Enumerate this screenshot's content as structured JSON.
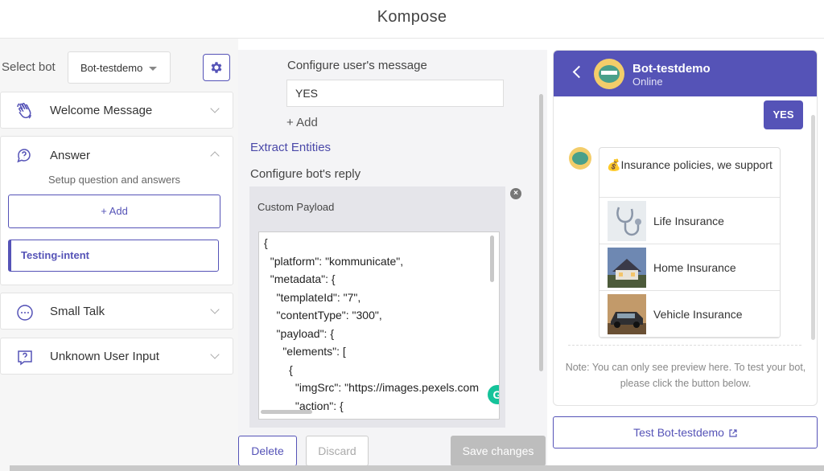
{
  "app": {
    "title": "Kompose"
  },
  "sidebar": {
    "select_label": "Select bot",
    "selected_bot": "Bot-testdemo",
    "sections": [
      {
        "label": "Welcome Message",
        "icon": "wave-hand-icon"
      },
      {
        "label": "Answer",
        "icon": "question-bubble-icon",
        "subtitle": "Setup question and answers",
        "add_label": "+ Add",
        "intent": "Testing-intent"
      },
      {
        "label": "Small Talk",
        "icon": "chat-dots-icon"
      },
      {
        "label": "Unknown User Input",
        "icon": "unknown-question-icon"
      }
    ]
  },
  "editor": {
    "user_message_label": "Configure user's message",
    "user_message_value": "YES",
    "add_label": "+ Add",
    "extract_entities": "Extract Entities",
    "bot_reply_label": "Configure bot's reply",
    "payload_title": "Custom Payload",
    "payload_code": "{\n  \"platform\": \"kommunicate\",\n  \"metadata\": {\n    \"templateId\": \"7\",\n    \"contentType\": \"300\",\n    \"payload\": {\n      \"elements\": [\n        {\n          \"imgSrc\": \"https://images.pexels.com\n          \"action\": {",
    "delete_label": "Delete",
    "discard_label": "Discard",
    "save_label": "Save changes"
  },
  "preview": {
    "bot_name": "Bot-testdemo",
    "status": "Online",
    "user_message": "YES",
    "list_title_emoji": "💰",
    "list_title": "Insurance policies, we support",
    "items": [
      {
        "label": "Life Insurance",
        "icon": "stethoscope-image"
      },
      {
        "label": "Home Insurance",
        "icon": "house-image"
      },
      {
        "label": "Vehicle Insurance",
        "icon": "car-image"
      }
    ],
    "note": "Note: You can only see preview here. To test your bot, please click the button below.",
    "test_button": "Test Bot-testdemo"
  },
  "colors": {
    "accent": "#5553b7",
    "save_disabled": "#bdbdbd",
    "grammarly": "#15c39a"
  }
}
